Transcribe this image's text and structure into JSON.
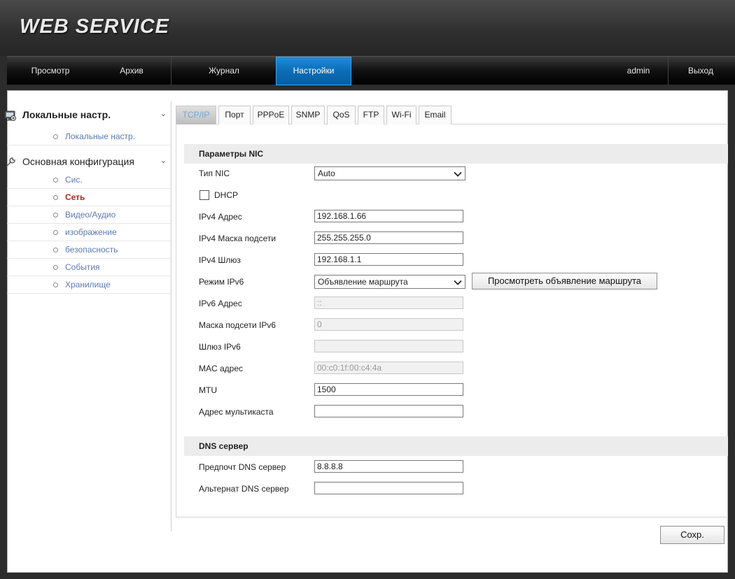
{
  "header": {
    "logo": "WEB SERVICE"
  },
  "nav": {
    "items": [
      {
        "label": "Просмотр"
      },
      {
        "label": "Архив"
      },
      {
        "label": "Журнал"
      },
      {
        "label": "Настройки"
      }
    ],
    "user": "admin",
    "logout": "Выход"
  },
  "sidebar": {
    "groups": [
      {
        "label": "Локальные настр.",
        "icon": "monitor-icon",
        "items": [
          {
            "label": "Локальные настр."
          }
        ]
      },
      {
        "label": "Основная конфигурация",
        "icon": "wrench-icon",
        "items": [
          {
            "label": "Сис."
          },
          {
            "label": "Сеть"
          },
          {
            "label": "Видео/Аудио"
          },
          {
            "label": "изображение"
          },
          {
            "label": "безопасность"
          },
          {
            "label": "События"
          },
          {
            "label": "Хранилище"
          }
        ]
      }
    ],
    "active_item": "Сеть"
  },
  "tabs": [
    {
      "label": "TCP/IP"
    },
    {
      "label": "Порт"
    },
    {
      "label": "PPPoE"
    },
    {
      "label": "SNMP"
    },
    {
      "label": "QoS"
    },
    {
      "label": "FTP"
    },
    {
      "label": "Wi-Fi"
    },
    {
      "label": "Email"
    }
  ],
  "nic": {
    "title": "Параметры NIC",
    "nic_type": {
      "label": "Тип NIC",
      "value": "Auto"
    },
    "dhcp": {
      "label": "DHCP",
      "checked": false
    },
    "ipv4_address": {
      "label": "IPv4 Адрес",
      "value": "192.168.1.66"
    },
    "ipv4_mask": {
      "label": "IPv4 Маска подсети",
      "value": "255.255.255.0"
    },
    "ipv4_gateway": {
      "label": "IPv4 Шлюз",
      "value": "192.168.1.1"
    },
    "ipv6_mode": {
      "label": "Режим IPv6",
      "value": "Объявление маршрута"
    },
    "view_route_button": "Просмотреть объявление маршрута",
    "ipv6_address": {
      "label": "IPv6 Адрес",
      "value": "::"
    },
    "ipv6_mask": {
      "label": "Маска подсети IPv6",
      "value": "0"
    },
    "ipv6_gateway": {
      "label": "Шлюз IPv6",
      "value": ""
    },
    "mac": {
      "label": "MAC адрес",
      "value": "00:c0:1f:00:c4:4a"
    },
    "mtu": {
      "label": "MTU",
      "value": "1500"
    },
    "multicast": {
      "label": "Адрес мультикаста",
      "value": ""
    }
  },
  "dns": {
    "title": "DNS сервер",
    "preferred": {
      "label": "Предпочт DNS сервер",
      "value": "8.8.8.8"
    },
    "alternate": {
      "label": "Альтернат DNS сервер",
      "value": ""
    }
  },
  "save_button": "Сохр.",
  "colors": {
    "active_nav": "#0b6db8",
    "active_sidebar": "#b0281e",
    "sidebar_link": "#5e79b4",
    "active_tab_text": "#6ea6d6"
  }
}
